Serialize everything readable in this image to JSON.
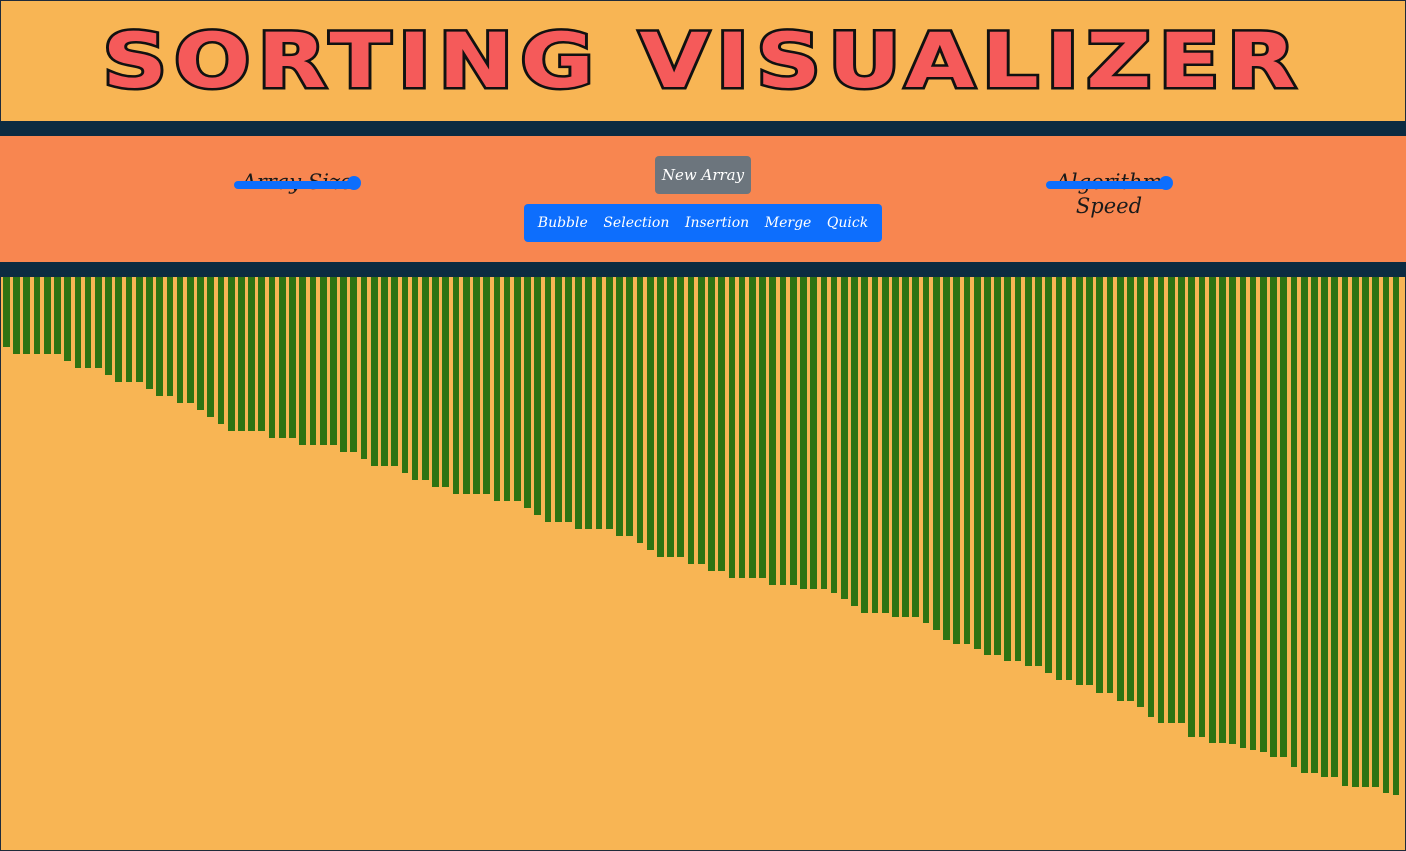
{
  "app": {
    "title": "SORTING VISUALIZER"
  },
  "controls": {
    "array_size_label": "Array Size",
    "algorithm_speed_label": "Algorithm Speed",
    "array_size_value": 1.0,
    "algorithm_speed_value": 1.0,
    "new_array_label": "New Array",
    "algorithms": [
      "Bubble",
      "Selection",
      "Insertion",
      "Merge",
      "Quick"
    ]
  },
  "colors": {
    "background": "#f8b554",
    "header_band": "#0c2b41",
    "controls_bg": "#f88650",
    "accent": "#0d6efd",
    "bar": "#2e7312",
    "title": "#f55a5a"
  },
  "array": {
    "values": [
      70,
      77,
      77,
      77,
      77,
      77,
      84,
      91,
      91,
      91,
      98,
      105,
      105,
      105,
      112,
      119,
      119,
      126,
      126,
      133,
      140,
      147,
      154,
      154,
      154,
      154,
      161,
      161,
      161,
      168,
      168,
      168,
      168,
      175,
      175,
      182,
      189,
      189,
      189,
      196,
      203,
      203,
      210,
      210,
      217,
      217,
      217,
      217,
      224,
      224,
      224,
      231,
      238,
      245,
      245,
      245,
      252,
      252,
      252,
      252,
      259,
      259,
      266,
      273,
      280,
      280,
      280,
      287,
      287,
      294,
      294,
      301,
      301,
      301,
      301,
      308,
      308,
      308,
      312,
      312,
      312,
      316,
      322,
      329,
      336,
      336,
      336,
      340,
      340,
      340,
      346,
      353,
      363,
      367,
      367,
      372,
      378,
      378,
      384,
      384,
      389,
      389,
      396,
      403,
      403,
      408,
      408,
      416,
      416,
      424,
      424,
      430,
      440,
      446,
      446,
      446,
      460,
      460,
      466,
      466,
      467,
      471,
      473,
      475,
      480,
      480,
      490,
      496,
      496,
      500,
      500,
      509,
      510,
      510,
      510,
      516,
      518
    ]
  }
}
